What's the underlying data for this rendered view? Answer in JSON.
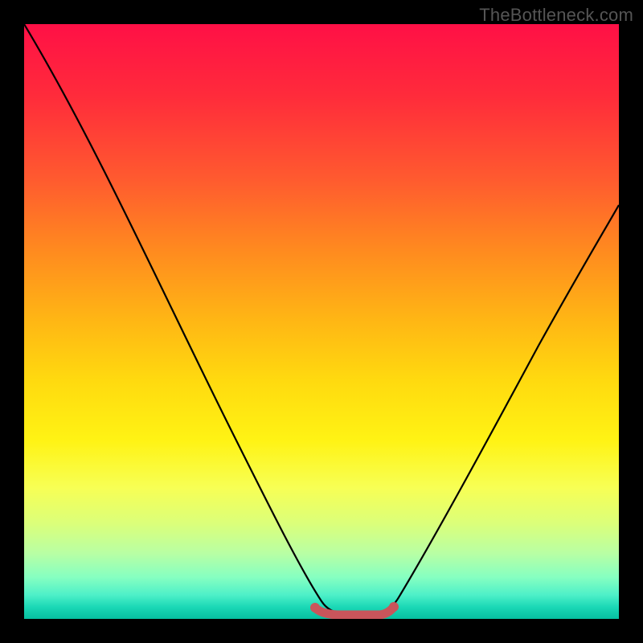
{
  "watermark": "TheBottleneck.com",
  "chart_data": {
    "type": "line",
    "title": "",
    "xlabel": "",
    "ylabel": "",
    "x": [
      0.0,
      0.05,
      0.1,
      0.15,
      0.2,
      0.25,
      0.3,
      0.35,
      0.4,
      0.45,
      0.5,
      0.525,
      0.55,
      0.575,
      0.6,
      0.65,
      0.7,
      0.75,
      0.8,
      0.85,
      0.9,
      0.95,
      1.0
    ],
    "values": [
      1.0,
      0.9,
      0.79,
      0.68,
      0.57,
      0.46,
      0.36,
      0.27,
      0.19,
      0.11,
      0.04,
      0.01,
      0.0,
      0.0,
      0.02,
      0.08,
      0.16,
      0.25,
      0.34,
      0.43,
      0.52,
      0.6,
      0.68
    ],
    "notch": {
      "x_range": [
        0.49,
        0.61
      ],
      "y": 0.01,
      "color": "#c9555b"
    },
    "xlim": [
      0,
      1
    ],
    "ylim": [
      0,
      1
    ],
    "gradient_colors_top_to_bottom": [
      "#ff1046",
      "#ffda0f",
      "#06bfa0"
    ]
  }
}
